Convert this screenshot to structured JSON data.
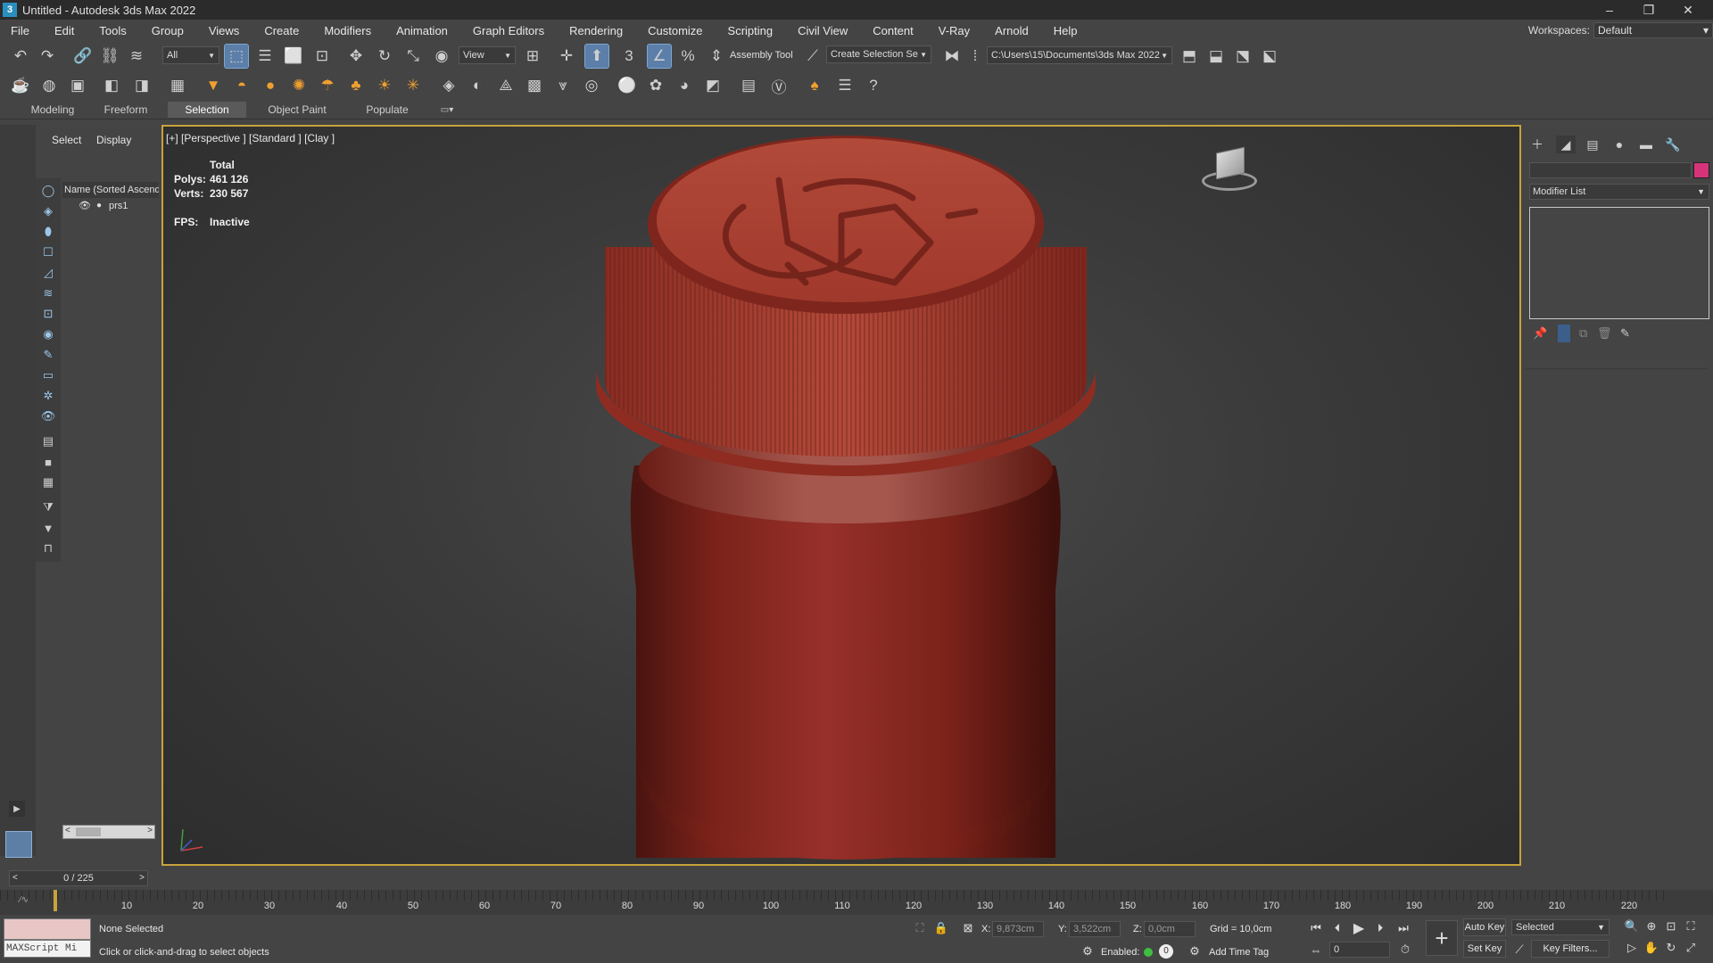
{
  "window": {
    "title": "Untitled - Autodesk 3ds Max 2022",
    "app_icon_letter": "3",
    "controls": [
      "–",
      "❐",
      "✕"
    ]
  },
  "menu": [
    "File",
    "Edit",
    "Tools",
    "Group",
    "Views",
    "Create",
    "Modifiers",
    "Animation",
    "Graph Editors",
    "Rendering",
    "Customize",
    "Scripting",
    "Civil View",
    "Content",
    "V-Ray",
    "Arnold",
    "Help"
  ],
  "workspaces": {
    "label": "Workspaces:",
    "value": "Default"
  },
  "toolbar": {
    "filter": "All",
    "ref_coord": "View",
    "assembly_tool": "Assembly Tool",
    "selection_set": "Create Selection Se",
    "project_path": "C:\\Users\\15\\Documents\\3ds Max 2022"
  },
  "ribbon_tabs": [
    "Modeling",
    "Freeform",
    "Selection",
    "Object Paint",
    "Populate"
  ],
  "active_ribbon_tab": "Selection",
  "scene_explorer": {
    "tabs": [
      "Select",
      "Display"
    ],
    "column_header": "Name (Sorted Ascend",
    "items": [
      {
        "name": "prs1"
      }
    ]
  },
  "viewport": {
    "label": "[+] [Perspective ] [Standard ] [Clay ]",
    "stats": {
      "total_label": "Total",
      "polys_label": "Polys:",
      "polys": "461 126",
      "verts_label": "Verts:",
      "verts": "230 567",
      "fps_label": "FPS:",
      "fps": "Inactive"
    },
    "object_color": "#8e2a20"
  },
  "command_panel": {
    "modifier_list": "Modifier List",
    "object_color": "#d6337a"
  },
  "timeline": {
    "frame": "0 / 225",
    "ticks": [
      "10",
      "20",
      "30",
      "40",
      "50",
      "60",
      "70",
      "80",
      "90",
      "100",
      "110",
      "120",
      "130",
      "140",
      "150",
      "160",
      "170",
      "180",
      "190",
      "200",
      "210",
      "220"
    ]
  },
  "status": {
    "maxscript": "MAXScript Mi",
    "selection": "None Selected",
    "prompt": "Click or click-and-drag to select objects",
    "x_label": "X:",
    "x": "9,873cm",
    "y_label": "Y:",
    "y": "3,522cm",
    "z_label": "Z:",
    "z": "0,0cm",
    "grid": "Grid = 10,0cm",
    "enabled_label": "Enabled:",
    "enabled_value": "0",
    "add_time_tag": "Add Time Tag",
    "auto_key": "Auto Key",
    "set_key": "Set Key",
    "key_mode": "Selected",
    "key_filters": "Key Filters...",
    "current_frame": "0"
  }
}
